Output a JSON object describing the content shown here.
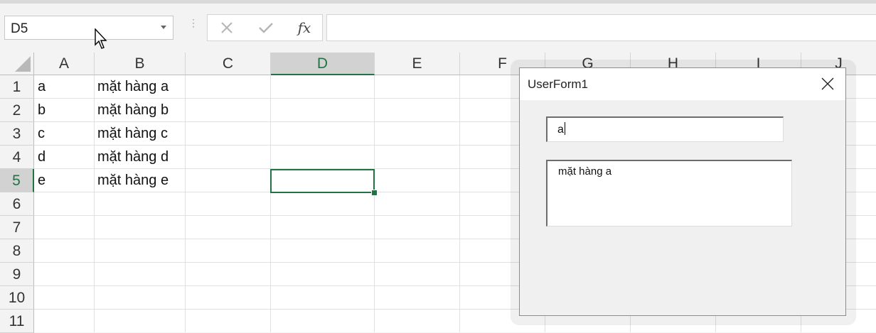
{
  "name_box": {
    "value": "D5"
  },
  "formula_bar": {
    "cancel_icon": "close-icon",
    "enter_icon": "check-icon",
    "function_label": "fx",
    "value": ""
  },
  "columns": [
    "A",
    "B",
    "C",
    "D",
    "E",
    "F",
    "G",
    "H",
    "I",
    "J"
  ],
  "rows": [
    "1",
    "2",
    "3",
    "4",
    "5",
    "6",
    "7",
    "8",
    "9",
    "10",
    "11"
  ],
  "selected_cell": {
    "column": "D",
    "row": "5"
  },
  "cells": {
    "A": [
      "a",
      "b",
      "c",
      "d",
      "e"
    ],
    "B": [
      "mặt hàng a",
      "mặt hàng b",
      "mặt hàng c",
      "mặt hàng d",
      "mặt hàng e"
    ]
  },
  "userform": {
    "title": "UserForm1",
    "textbox1_value": "a",
    "textbox2_value": "mặt hàng a"
  },
  "colors": {
    "accent": "#217346",
    "header_bg": "#f3f3f3",
    "grid_line": "#e1e1e1"
  }
}
